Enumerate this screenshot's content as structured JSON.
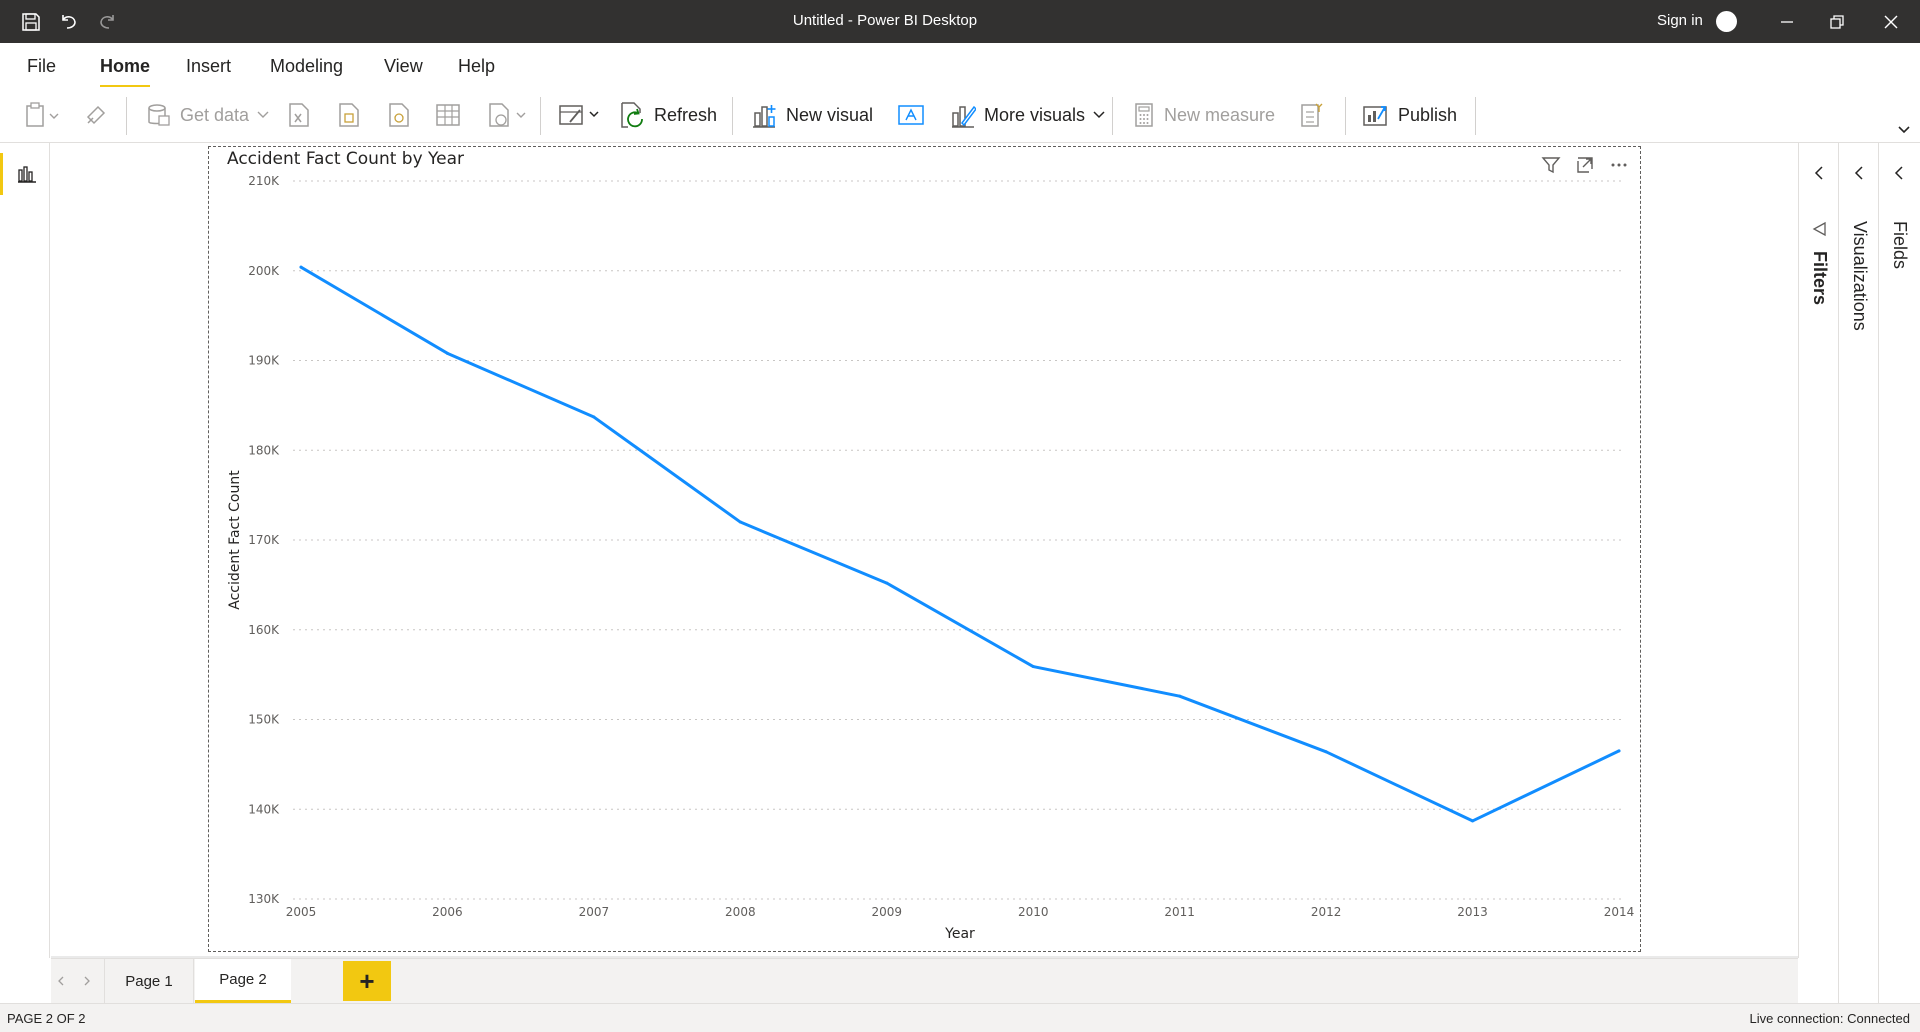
{
  "window": {
    "title": "Untitled - Power BI Desktop",
    "sign_in": "Sign in",
    "quick_access": [
      "save-icon",
      "undo-icon",
      "redo-icon"
    ],
    "controls": [
      "minimize-icon",
      "restore-icon",
      "close-icon"
    ]
  },
  "menu": {
    "tabs": [
      "File",
      "Home",
      "Insert",
      "Modeling",
      "View",
      "Help"
    ],
    "active": "Home"
  },
  "ribbon": {
    "get_data": "Get data",
    "refresh": "Refresh",
    "new_visual": "New visual",
    "more_visuals": "More visuals",
    "new_measure": "New measure",
    "publish": "Publish"
  },
  "visual": {
    "title": "Accident Fact Count by Year",
    "header_icons": [
      "filter-icon",
      "focus-mode-icon",
      "more-options-icon"
    ]
  },
  "chart_data": {
    "type": "line",
    "title": "Accident Fact Count by Year",
    "xlabel": "Year",
    "ylabel": "Accident Fact Count",
    "x": [
      2005,
      2006,
      2007,
      2008,
      2009,
      2010,
      2011,
      2012,
      2013,
      2014
    ],
    "x_tick_labels": [
      "2005",
      "2006",
      "2007",
      "2008",
      "2009",
      "2010",
      "2011",
      "2012",
      "2013",
      "2014"
    ],
    "series": [
      {
        "values": [
          200400,
          190800,
          183700,
          172000,
          165200,
          155900,
          152600,
          146400,
          138700,
          146500
        ],
        "color": "#118dff"
      }
    ],
    "ylim": [
      130000,
      210000
    ],
    "y_ticks": [
      130000,
      140000,
      150000,
      160000,
      170000,
      180000,
      190000,
      200000,
      210000
    ],
    "y_tick_labels": [
      "130K",
      "140K",
      "150K",
      "160K",
      "170K",
      "180K",
      "190K",
      "200K",
      "210K"
    ],
    "grid": "horizontal dotted"
  },
  "panes": {
    "filters": "Filters",
    "visualizations": "Visualizations",
    "fields": "Fields"
  },
  "pages": {
    "tabs": [
      "Page 1",
      "Page 2"
    ],
    "active": "Page 2",
    "add": "+"
  },
  "status": {
    "page_indicator": "PAGE 2 OF 2",
    "connection": "Live connection: Connected"
  },
  "colors": {
    "accent": "#f2c811",
    "line": "#118dff",
    "titlebar": "#323130"
  }
}
